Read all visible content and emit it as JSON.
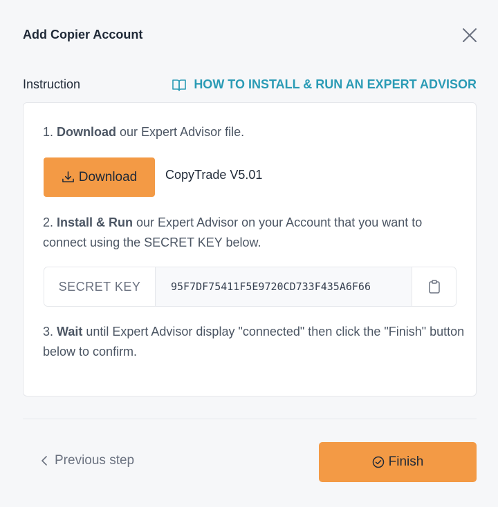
{
  "header": {
    "title": "Add Copier Account",
    "close_icon": "close-icon"
  },
  "instruction": {
    "label": "Instruction",
    "howto_link": "HOW TO INSTALL & RUN AN EXPERT ADVISOR",
    "howto_icon": "book-open-icon"
  },
  "steps": {
    "step1": {
      "prefix": "1. ",
      "bold": "Download",
      "rest": " our Expert Advisor file."
    },
    "step2": {
      "prefix": "2. ",
      "bold": "Install & Run",
      "rest": " our Expert Advisor on your Account that you want to connect using the SECRET KEY below."
    },
    "step3": {
      "prefix": "3. ",
      "bold": "Wait",
      "rest": " until Expert Advisor display \"connected\" then click the \"Finish\" button below to confirm."
    }
  },
  "download": {
    "button_label": "Download",
    "icon": "download-icon",
    "version": "CopyTrade V5.01"
  },
  "secret": {
    "label": "SECRET KEY",
    "value": "95F7DF75411F5E9720CD733F435A6F66",
    "copy_icon": "clipboard-icon"
  },
  "footer": {
    "previous_label": "Previous step",
    "finish_label": "Finish",
    "accent_color": "#f39a45",
    "link_color": "#2a9bb5"
  }
}
